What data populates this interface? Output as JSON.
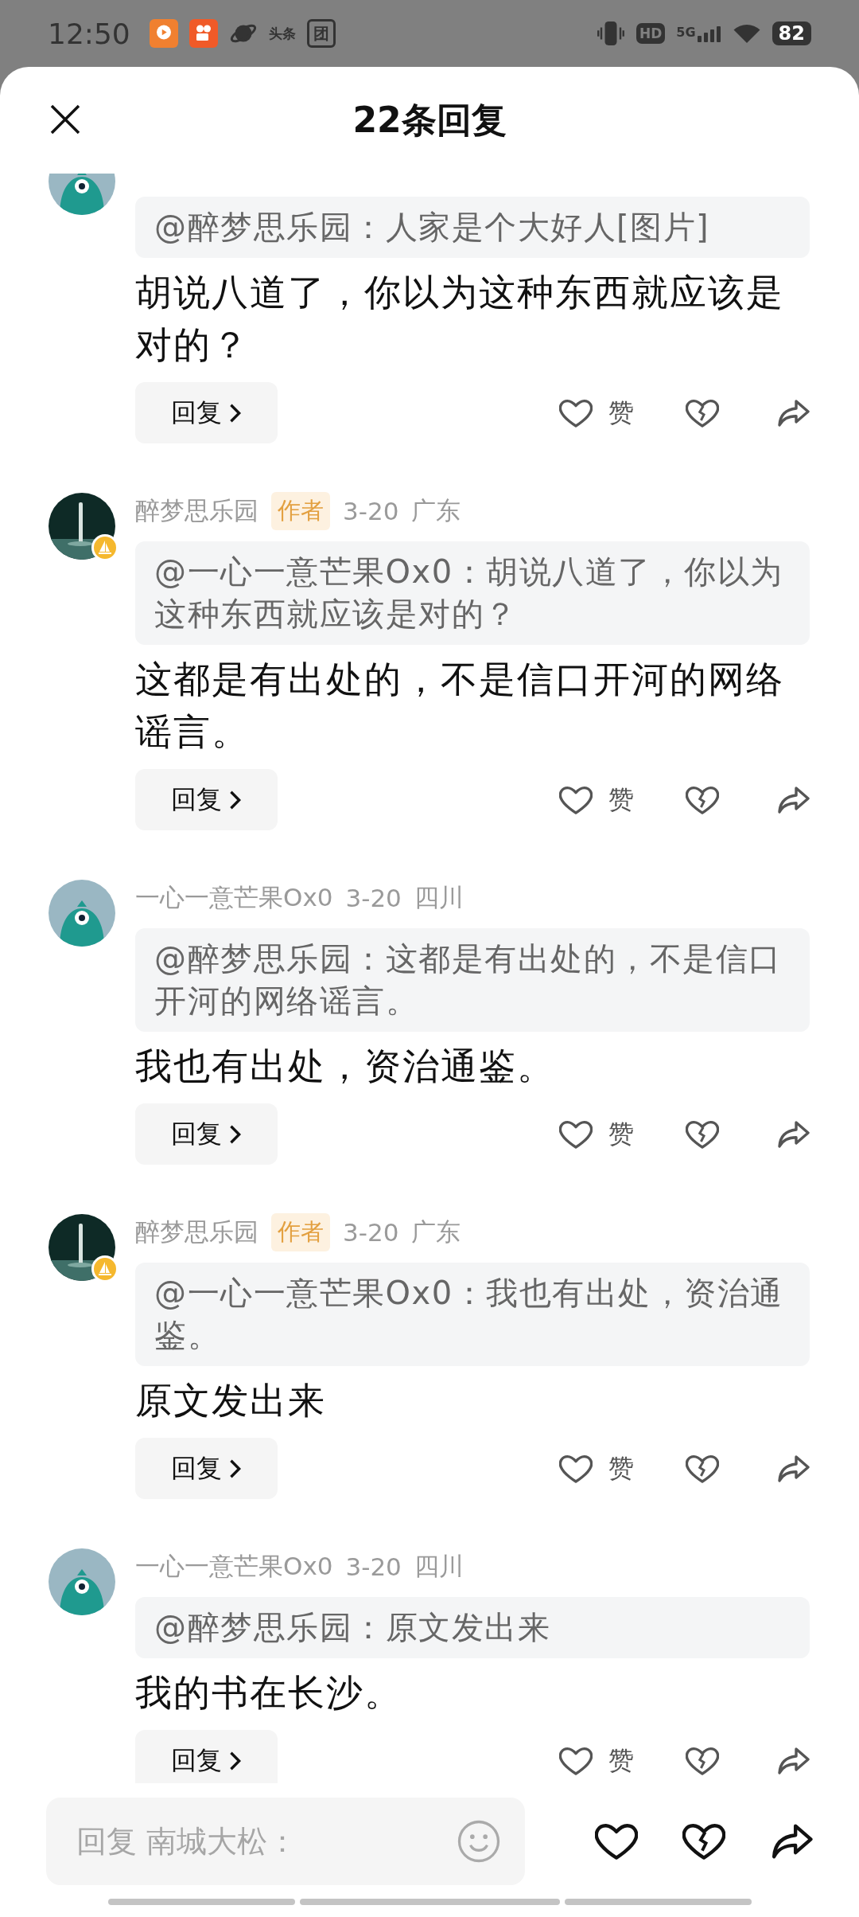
{
  "status_bar": {
    "time": "12:50",
    "notifications": [
      {
        "kind": "video-app"
      },
      {
        "kind": "camera-app"
      },
      {
        "kind": "planet"
      },
      {
        "kind": "text",
        "label": "头条"
      },
      {
        "kind": "text-box",
        "label": "团"
      }
    ],
    "hd_label": "HD",
    "network_label": "5G",
    "battery": "82"
  },
  "header": {
    "title": "22条回复"
  },
  "comments": [
    {
      "kind": "partial",
      "avatar": {
        "kind": "mascot"
      },
      "verified": false,
      "quote": "@醉梦思乐园：人家是个大好人[图片]",
      "text": "胡说八道了，你以为这种东西就应该是对的？",
      "reply_label": "回复",
      "like_label": "赞"
    },
    {
      "kind": "full",
      "avatar": {
        "kind": "photo"
      },
      "verified": true,
      "author": "醉梦思乐园",
      "badge": "作者",
      "date": "3-20",
      "location": "广东",
      "quote": "@一心一意芒果Ox0：胡说八道了，你以为这种东西就应该是对的？",
      "text": "这都是有出处的，不是信口开河的网络谣言。",
      "reply_label": "回复",
      "like_label": "赞"
    },
    {
      "kind": "full",
      "avatar": {
        "kind": "mascot"
      },
      "verified": false,
      "author": "一心一意芒果Ox0",
      "date": "3-20",
      "location": "四川",
      "quote": "@醉梦思乐园：这都是有出处的，不是信口开河的网络谣言。",
      "text": "我也有出处，资治通鉴。",
      "reply_label": "回复",
      "like_label": "赞"
    },
    {
      "kind": "full",
      "avatar": {
        "kind": "photo"
      },
      "verified": true,
      "author": "醉梦思乐园",
      "badge": "作者",
      "date": "3-20",
      "location": "广东",
      "quote": "@一心一意芒果Ox0：我也有出处，资治通鉴。",
      "text": "原文发出来",
      "reply_label": "回复",
      "like_label": "赞"
    },
    {
      "kind": "full",
      "avatar": {
        "kind": "mascot"
      },
      "verified": false,
      "author": "一心一意芒果Ox0",
      "date": "3-20",
      "location": "四川",
      "quote": "@醉梦思乐园：原文发出来",
      "text": "我的书在长沙。",
      "reply_label": "回复",
      "like_label": "赞"
    }
  ],
  "reply_bar": {
    "placeholder": "回复 南城大松："
  }
}
